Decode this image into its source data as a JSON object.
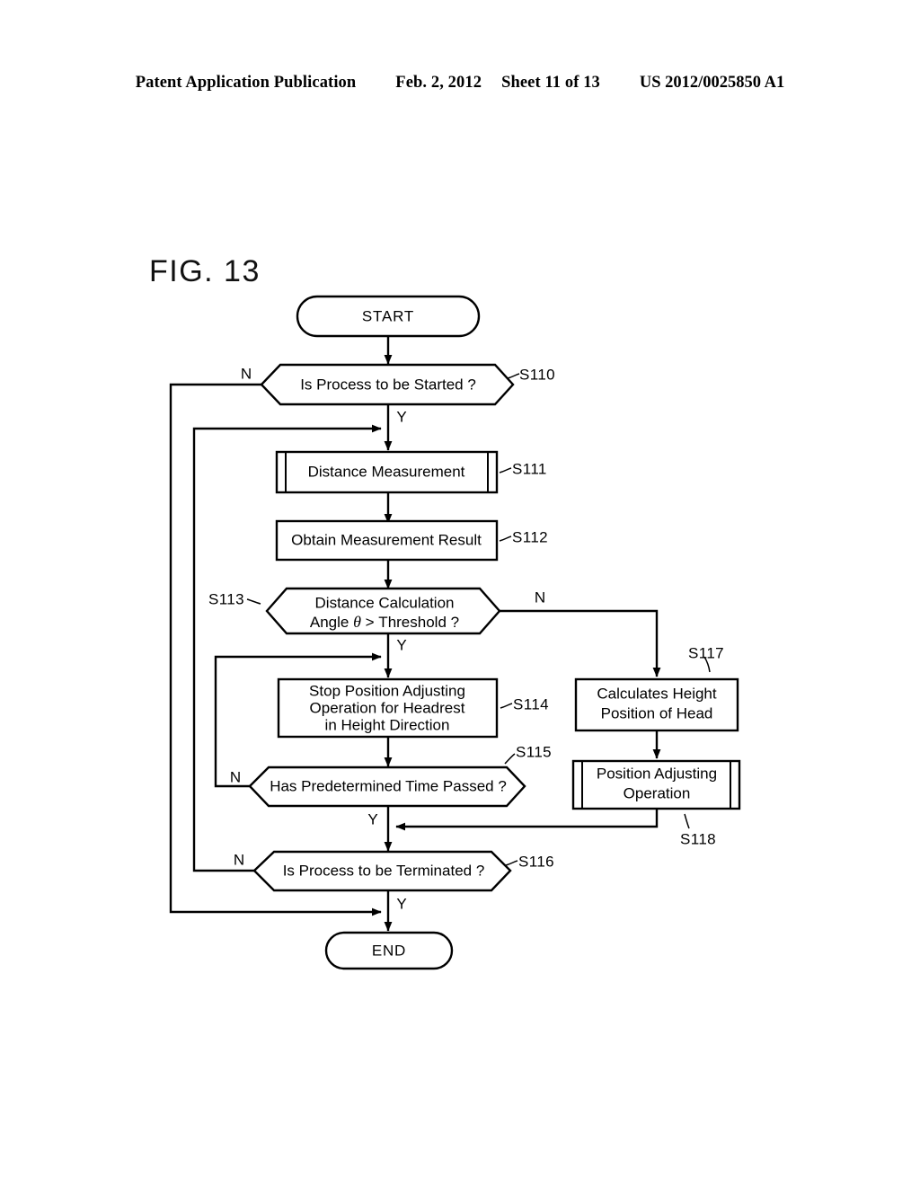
{
  "header": {
    "publication": "Patent Application Publication",
    "date": "Feb. 2, 2012",
    "sheet": "Sheet 11 of 13",
    "pub_number": "US 2012/0025850 A1"
  },
  "figure": {
    "label": "FIG. 13"
  },
  "chart_data": {
    "type": "diagram",
    "diagram_kind": "flowchart",
    "title": "FIG. 13",
    "nodes": [
      {
        "id": "start",
        "shape": "terminator",
        "text": "START",
        "step": ""
      },
      {
        "id": "s110",
        "shape": "decision-hexagon",
        "text": "Is Process to be Started ?",
        "step": "S110"
      },
      {
        "id": "s111",
        "shape": "predefined-process",
        "text": "Distance Measurement",
        "step": "S111"
      },
      {
        "id": "s112",
        "shape": "process",
        "text": "Obtain Measurement Result",
        "step": "S112"
      },
      {
        "id": "s113",
        "shape": "decision-hexagon",
        "text": "Distance Calculation Angle θ > Threshold ?",
        "step": "S113"
      },
      {
        "id": "s114",
        "shape": "process",
        "text": "Stop Position Adjusting Operation for Headrest in Height Direction",
        "step": "S114"
      },
      {
        "id": "s115",
        "shape": "decision-hexagon",
        "text": "Has Predetermined Time Passed ?",
        "step": "S115"
      },
      {
        "id": "s116",
        "shape": "decision-hexagon",
        "text": "Is Process to be Terminated ?",
        "step": "S116"
      },
      {
        "id": "s117",
        "shape": "process",
        "text": "Calculates Height Position of Head",
        "step": "S117"
      },
      {
        "id": "s118",
        "shape": "predefined-process",
        "text": "Position Adjusting Operation",
        "step": "S118"
      },
      {
        "id": "end",
        "shape": "terminator",
        "text": "END",
        "step": ""
      }
    ],
    "edges": [
      {
        "from": "start",
        "to": "s110",
        "label": ""
      },
      {
        "from": "s110",
        "to": "s111",
        "label": "Y"
      },
      {
        "from": "s110",
        "to": "end",
        "label": "N"
      },
      {
        "from": "s111",
        "to": "s112",
        "label": ""
      },
      {
        "from": "s112",
        "to": "s113",
        "label": ""
      },
      {
        "from": "s113",
        "to": "s114",
        "label": "Y"
      },
      {
        "from": "s113",
        "to": "s117",
        "label": "N"
      },
      {
        "from": "s114",
        "to": "s115",
        "label": ""
      },
      {
        "from": "s115",
        "to": "s116",
        "label": "Y"
      },
      {
        "from": "s115",
        "to": "s114",
        "label": "N"
      },
      {
        "from": "s116",
        "to": "end",
        "label": "Y"
      },
      {
        "from": "s116",
        "to": "s111",
        "label": "N"
      },
      {
        "from": "s117",
        "to": "s118",
        "label": ""
      },
      {
        "from": "s118",
        "to": "s116",
        "label": ""
      }
    ]
  },
  "nodes": {
    "start": {
      "text": "START"
    },
    "end": {
      "text": "END"
    },
    "s110": {
      "text": "Is Process to be Started ?",
      "step": "S110"
    },
    "s111": {
      "text": "Distance Measurement",
      "step": "S111"
    },
    "s112": {
      "text": "Obtain Measurement Result",
      "step": "S112"
    },
    "s113": {
      "line1": "Distance Calculation",
      "line2_pre": "Angle ",
      "line2_theta": "θ",
      "line2_post": " > Threshold ?",
      "step": "S113"
    },
    "s114": {
      "line1": "Stop Position Adjusting",
      "line2": "Operation for Headrest",
      "line3": "in Height Direction",
      "step": "S114"
    },
    "s115": {
      "text": "Has Predetermined Time Passed ?",
      "step": "S115"
    },
    "s116": {
      "text": "Is Process to be Terminated ?",
      "step": "S116"
    },
    "s117": {
      "line1": "Calculates Height",
      "line2": "Position of Head",
      "step": "S117"
    },
    "s118": {
      "line1": "Position Adjusting",
      "line2": "Operation",
      "step": "S118"
    }
  },
  "branches": {
    "s110_n": "N",
    "s110_y": "Y",
    "s113_n": "N",
    "s113_y": "Y",
    "s115_n": "N",
    "s115_y": "Y",
    "s116_n": "N",
    "s116_y": "Y"
  },
  "colors": {
    "ink": "#000000",
    "paper": "#ffffff"
  }
}
